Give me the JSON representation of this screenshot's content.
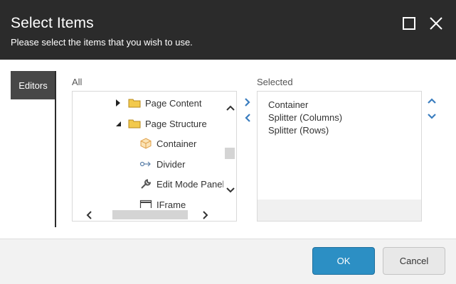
{
  "dialog": {
    "title": "Select Items",
    "subtitle": "Please select the items that you wish to use.",
    "maximize_icon": "square-outline-icon",
    "close_icon": "close-x-icon"
  },
  "tabs": [
    {
      "label": "Editors",
      "active": true
    }
  ],
  "all_panel": {
    "label": "All",
    "tree": [
      {
        "label": "Page Content",
        "icon": "folder-icon",
        "arrow": "expand-right"
      },
      {
        "label": "Page Structure",
        "icon": "folder-icon",
        "arrow": "collapse-down"
      },
      {
        "label": "Container",
        "icon": "cube-icon"
      },
      {
        "label": "Divider",
        "icon": "divider-arrow-icon"
      },
      {
        "label": "Edit Mode Panel",
        "icon": "wrench-icon"
      },
      {
        "label": "IFrame",
        "icon": "window-icon"
      }
    ]
  },
  "selected_panel": {
    "label": "Selected",
    "items": [
      "Container",
      "Splitter (Columns)",
      "Splitter (Rows)"
    ]
  },
  "footer": {
    "ok_label": "OK",
    "cancel_label": "Cancel"
  },
  "colors": {
    "header_bg": "#2b2b2b",
    "accent_blue": "#2c8fc4",
    "arrow_blue": "#3a7dbf",
    "folder_yellow": "#f2c94c"
  }
}
